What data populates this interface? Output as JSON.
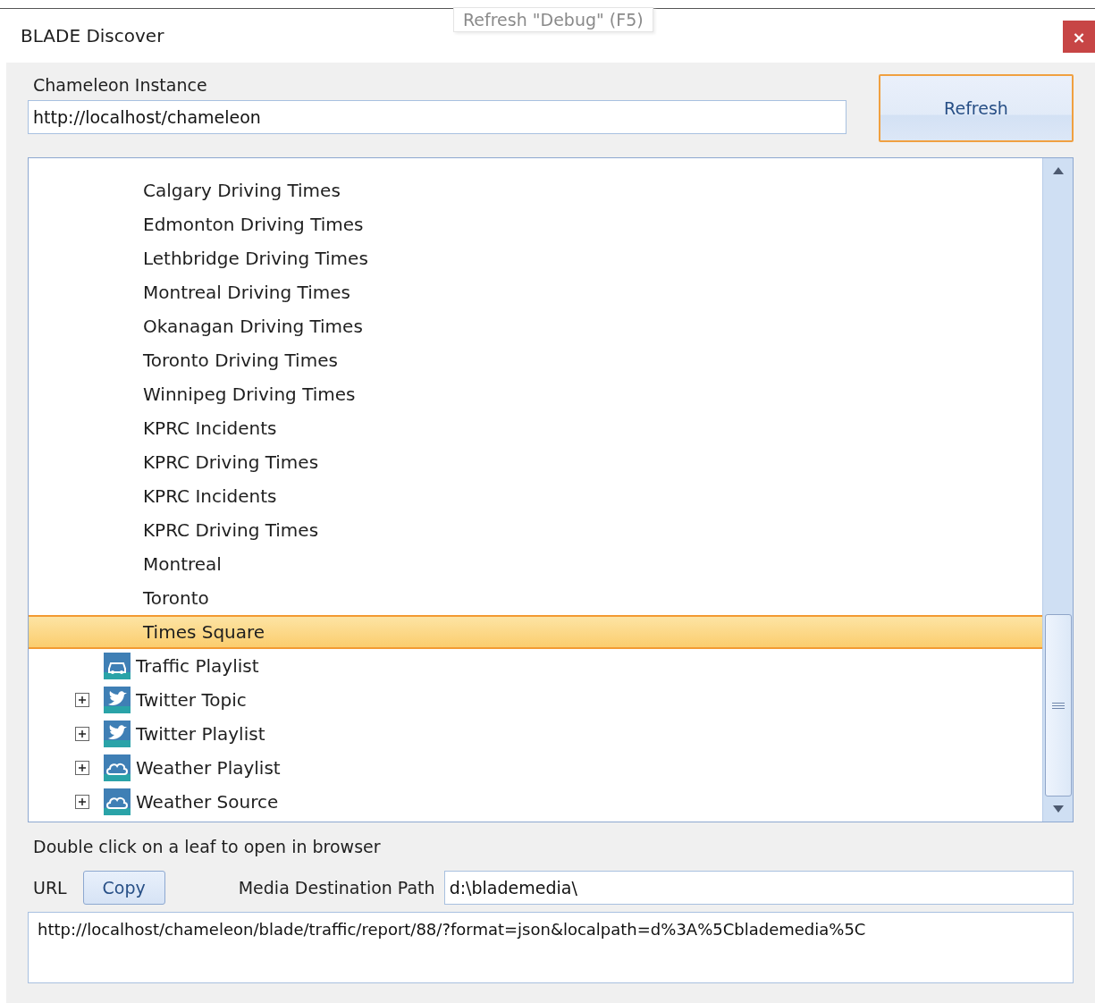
{
  "window": {
    "title": "BLADE Discover",
    "close": "×"
  },
  "tooltip": "Refresh \"Debug\" (F5)",
  "instance": {
    "label": "Chameleon Instance",
    "value": "http://localhost/chameleon"
  },
  "refresh_button": "Refresh",
  "tree": {
    "partial_group": [
      {
        "label": "Calgary Driving Times",
        "selected": false
      },
      {
        "label": "Edmonton Driving Times",
        "selected": false
      },
      {
        "label": "Lethbridge Driving Times",
        "selected": false
      },
      {
        "label": "Montreal Driving Times",
        "selected": false
      },
      {
        "label": "Okanagan Driving Times",
        "selected": false
      },
      {
        "label": "Toronto Driving Times",
        "selected": false
      },
      {
        "label": "Winnipeg Driving Times",
        "selected": false
      },
      {
        "label": "KPRC Incidents",
        "selected": false
      },
      {
        "label": "KPRC Driving Times",
        "selected": false
      },
      {
        "label": "KPRC Incidents",
        "selected": false
      },
      {
        "label": "KPRC Driving Times",
        "selected": false
      },
      {
        "label": "Montreal",
        "selected": false
      },
      {
        "label": "Toronto",
        "selected": false
      },
      {
        "label": "Times Square",
        "selected": true
      }
    ],
    "items": [
      {
        "label": "Traffic Playlist",
        "kind": "traffic",
        "selected": false
      },
      {
        "label": "Twitter Topic",
        "kind": "twitter",
        "expanded": false,
        "selected": false
      },
      {
        "label": "Twitter Playlist",
        "kind": "twitter",
        "expanded": false,
        "selected": false
      },
      {
        "label": "Weather Playlist",
        "kind": "weather",
        "expanded": false,
        "selected": false
      },
      {
        "label": "Weather Source",
        "kind": "weather",
        "expanded": false,
        "selected": false
      }
    ]
  },
  "hint": "Double click on a leaf to open in browser",
  "url_label": "URL",
  "copy_button": "Copy",
  "media": {
    "label": "Media Destination Path",
    "value": "d:\\blademedia\\"
  },
  "url_value": "http://localhost/chameleon/blade/traffic/report/88/?format=json&localpath=d%3A%5Cblademedia%5C"
}
